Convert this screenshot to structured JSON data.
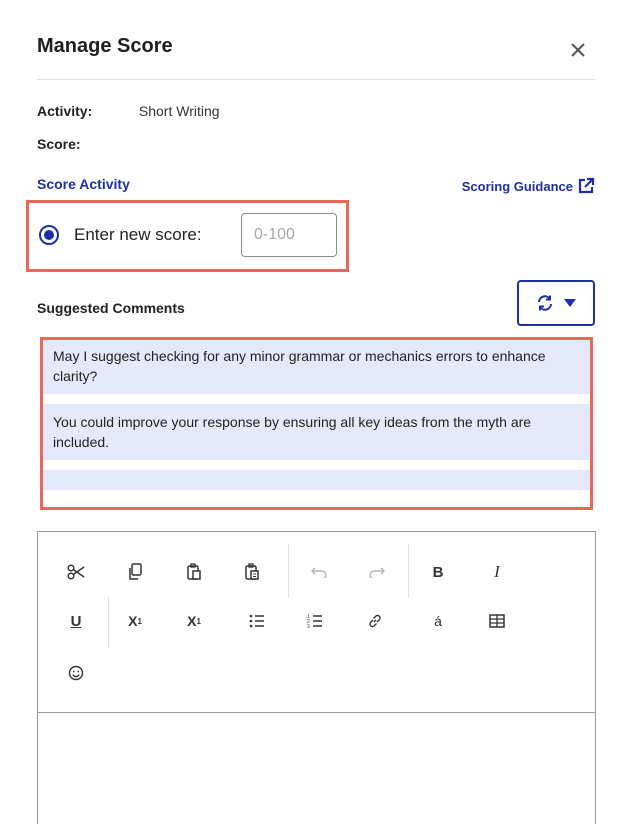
{
  "dialog": {
    "title": "Manage Score"
  },
  "meta": {
    "activity_label": "Activity:",
    "activity_value": "Short Writing",
    "score_label": "Score:",
    "score_value": ""
  },
  "score_section": {
    "heading": "Score Activity",
    "guidance_link": "Scoring Guidance",
    "radio_label": "Enter new score:",
    "input_placeholder": "0-100",
    "input_value": ""
  },
  "suggestions": {
    "heading": "Suggested Comments",
    "items": [
      "May I suggest checking for any minor grammar or mechanics errors to enhance clarity?",
      "You could improve your response by ensuring all key ideas from the myth are included."
    ]
  },
  "toolbar": {
    "buttons": [
      {
        "name": "cut-button",
        "glyph": "✂"
      },
      {
        "name": "copy-button",
        "glyph": "⧉"
      },
      {
        "name": "paste-button",
        "glyph": "📋"
      },
      {
        "name": "paste-from-word-button",
        "glyph": "📋"
      },
      {
        "name": "undo-button",
        "glyph": "↶"
      },
      {
        "name": "redo-button",
        "glyph": "↷"
      },
      {
        "name": "bold-button",
        "glyph": "B"
      },
      {
        "name": "italic-button",
        "glyph": "I"
      },
      {
        "name": "underline-button",
        "glyph": "U"
      },
      {
        "name": "superscript-button",
        "glyph": "X¹"
      },
      {
        "name": "subscript-button",
        "glyph": "X₁"
      },
      {
        "name": "bulleted-list-button",
        "glyph": "☰"
      },
      {
        "name": "numbered-list-button",
        "glyph": "☰"
      },
      {
        "name": "link-button",
        "glyph": "🔗"
      },
      {
        "name": "special-char-button",
        "glyph": "á"
      },
      {
        "name": "table-button",
        "glyph": "⊞"
      },
      {
        "name": "emoji-button",
        "glyph": "☺"
      }
    ]
  },
  "colors": {
    "accent": "#1d2fa6",
    "highlight_border": "#e8685a",
    "comment_bg": "#e6e9fb"
  }
}
